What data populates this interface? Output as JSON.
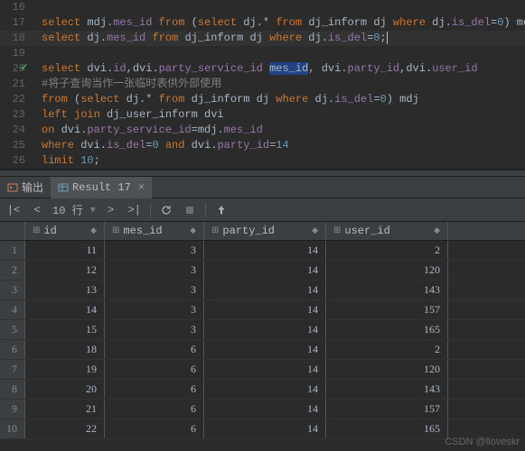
{
  "editor": {
    "lines": [
      {
        "n": 16,
        "tokens": []
      },
      {
        "n": 17,
        "tokens": [
          [
            "kw",
            "select"
          ],
          [
            "fn",
            " mdj"
          ],
          [
            "fn",
            "."
          ],
          [
            "id",
            "mes_id"
          ],
          [
            "fn",
            " "
          ],
          [
            "kw",
            "from"
          ],
          [
            "fn",
            " ("
          ],
          [
            "kw",
            "select"
          ],
          [
            "fn",
            " dj"
          ],
          [
            "fn",
            "."
          ],
          [
            "fn",
            "* "
          ],
          [
            "kw",
            "from"
          ],
          [
            "fn",
            " dj_inform dj "
          ],
          [
            "kw",
            "where"
          ],
          [
            "fn",
            " dj"
          ],
          [
            "fn",
            "."
          ],
          [
            "id",
            "is_del"
          ],
          [
            "fn",
            "="
          ],
          [
            "num",
            "0"
          ],
          [
            "fn",
            ") mdj;"
          ]
        ]
      },
      {
        "n": 18,
        "hl": true,
        "tokens": [
          [
            "kw",
            "select"
          ],
          [
            "fn",
            " dj"
          ],
          [
            "fn",
            "."
          ],
          [
            "id",
            "mes_id"
          ],
          [
            "fn",
            " "
          ],
          [
            "kw",
            "from"
          ],
          [
            "fn",
            " dj_inform dj "
          ],
          [
            "kw",
            "where"
          ],
          [
            "fn",
            " dj"
          ],
          [
            "fn",
            "."
          ],
          [
            "id",
            "is_del"
          ],
          [
            "fn",
            "="
          ],
          [
            "num",
            "0"
          ],
          [
            "fn",
            ";"
          ]
        ]
      },
      {
        "n": 19,
        "tokens": []
      },
      {
        "n": 20,
        "check": true,
        "tokens": [
          [
            "kw",
            "select"
          ],
          [
            "fn",
            " dvi"
          ],
          [
            "fn",
            "."
          ],
          [
            "id",
            "id"
          ],
          [
            "fn",
            ",dvi"
          ],
          [
            "fn",
            "."
          ],
          [
            "id",
            "party_service_id"
          ],
          [
            "fn",
            " "
          ],
          [
            "hl",
            "mes_id"
          ],
          [
            "fn",
            ", dvi"
          ],
          [
            "fn",
            "."
          ],
          [
            "id",
            "party_id"
          ],
          [
            "fn",
            ",dvi"
          ],
          [
            "fn",
            "."
          ],
          [
            "id",
            "user_id"
          ]
        ]
      },
      {
        "n": 21,
        "tokens": [
          [
            "cmt",
            "#将子查询当作一张临时表供外部使用"
          ]
        ]
      },
      {
        "n": 22,
        "tokens": [
          [
            "kw",
            "from"
          ],
          [
            "fn",
            " ("
          ],
          [
            "kw",
            "select"
          ],
          [
            "fn",
            " dj"
          ],
          [
            "fn",
            "."
          ],
          [
            "fn",
            "* "
          ],
          [
            "kw",
            "from"
          ],
          [
            "fn",
            " dj_inform dj "
          ],
          [
            "kw",
            "where"
          ],
          [
            "fn",
            " dj"
          ],
          [
            "fn",
            "."
          ],
          [
            "id",
            "is_del"
          ],
          [
            "fn",
            "="
          ],
          [
            "num",
            "0"
          ],
          [
            "fn",
            ") mdj"
          ]
        ]
      },
      {
        "n": 23,
        "tokens": [
          [
            "kw",
            "left join"
          ],
          [
            "fn",
            " dj_user_inform dvi"
          ]
        ]
      },
      {
        "n": 24,
        "tokens": [
          [
            "kw",
            "on"
          ],
          [
            "fn",
            " dvi"
          ],
          [
            "fn",
            "."
          ],
          [
            "id",
            "party_service_id"
          ],
          [
            "fn",
            "=mdj"
          ],
          [
            "fn",
            "."
          ],
          [
            "id",
            "mes_id"
          ]
        ]
      },
      {
        "n": 25,
        "tokens": [
          [
            "kw",
            "where"
          ],
          [
            "fn",
            " dvi"
          ],
          [
            "fn",
            "."
          ],
          [
            "id",
            "is_del"
          ],
          [
            "fn",
            "="
          ],
          [
            "num",
            "0"
          ],
          [
            "fn",
            " "
          ],
          [
            "kw",
            "and"
          ],
          [
            "fn",
            " dvi"
          ],
          [
            "fn",
            "."
          ],
          [
            "id",
            "party_id"
          ],
          [
            "fn",
            "="
          ],
          [
            "num",
            "14"
          ]
        ]
      },
      {
        "n": 26,
        "tokens": [
          [
            "kw",
            "limit"
          ],
          [
            "fn",
            " "
          ],
          [
            "num",
            "10"
          ],
          [
            "fn",
            ";"
          ]
        ]
      }
    ]
  },
  "tabs": {
    "output": "输出",
    "result": "Result 17"
  },
  "toolbar": {
    "rows_label": "10 行",
    "nav_first": "|<",
    "nav_prev": "<",
    "nav_next": ">",
    "nav_last": ">|"
  },
  "grid": {
    "columns": [
      "id",
      "mes_id",
      "party_id",
      "user_id"
    ],
    "rows": [
      {
        "n": 1,
        "id": 11,
        "mes_id": 3,
        "party_id": 14,
        "user_id": 2
      },
      {
        "n": 2,
        "id": 12,
        "mes_id": 3,
        "party_id": 14,
        "user_id": 120
      },
      {
        "n": 3,
        "id": 13,
        "mes_id": 3,
        "party_id": 14,
        "user_id": 143
      },
      {
        "n": 4,
        "id": 14,
        "mes_id": 3,
        "party_id": 14,
        "user_id": 157
      },
      {
        "n": 5,
        "id": 15,
        "mes_id": 3,
        "party_id": 14,
        "user_id": 165
      },
      {
        "n": 6,
        "id": 18,
        "mes_id": 6,
        "party_id": 14,
        "user_id": 2
      },
      {
        "n": 7,
        "id": 19,
        "mes_id": 6,
        "party_id": 14,
        "user_id": 120
      },
      {
        "n": 8,
        "id": 20,
        "mes_id": 6,
        "party_id": 14,
        "user_id": 143
      },
      {
        "n": 9,
        "id": 21,
        "mes_id": 6,
        "party_id": 14,
        "user_id": 157
      },
      {
        "n": 10,
        "id": 22,
        "mes_id": 6,
        "party_id": 14,
        "user_id": 165
      }
    ]
  },
  "watermark": "CSDN @lloveskr"
}
